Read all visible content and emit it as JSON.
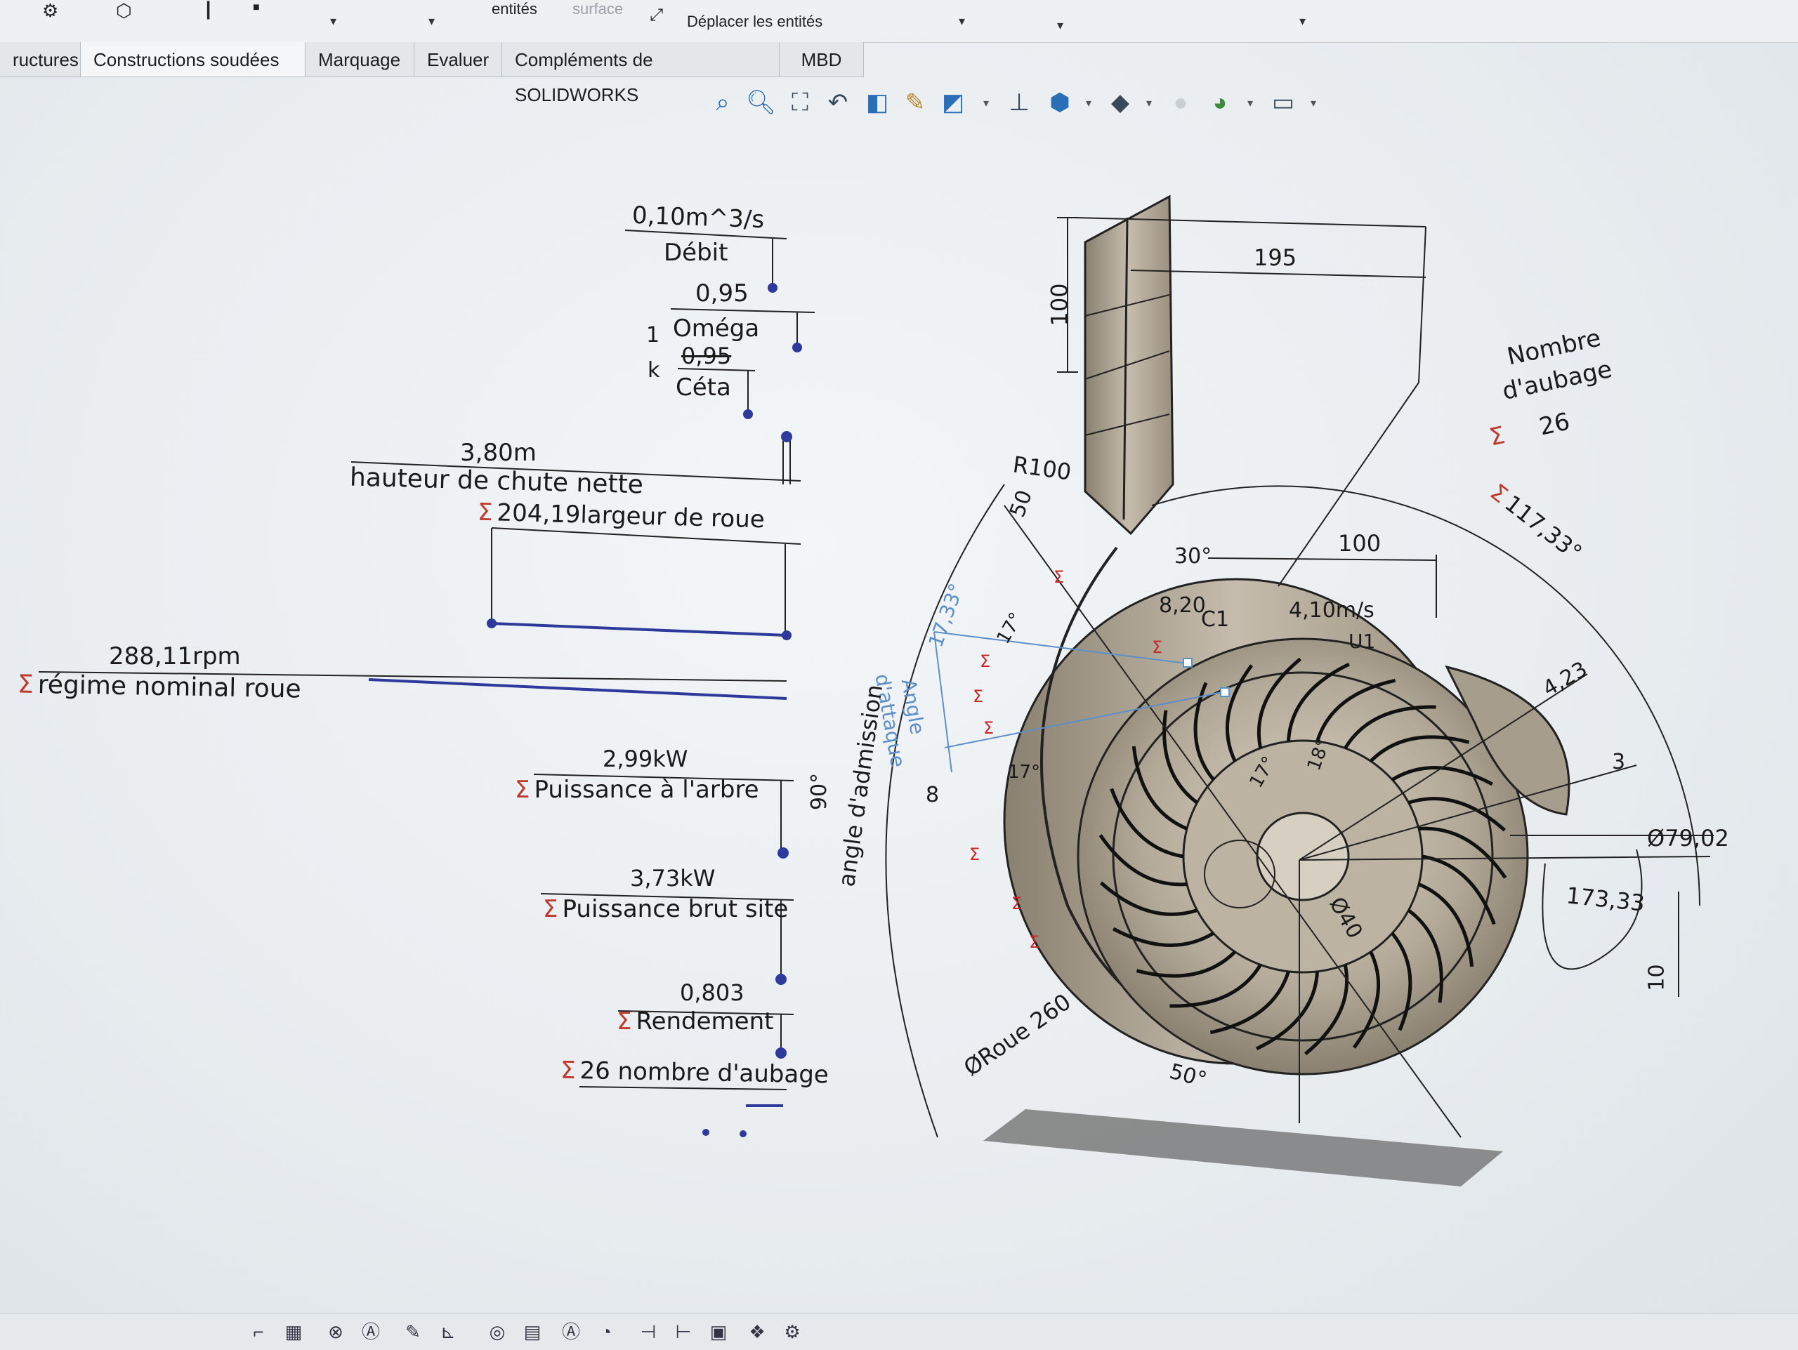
{
  "toolbar": {
    "item_entites": "entités",
    "item_surface": "surface",
    "move_entities": "Déplacer les entités"
  },
  "tabs": [
    {
      "label": "ructures"
    },
    {
      "label": "Constructions soudées"
    },
    {
      "label": "Marquage"
    },
    {
      "label": "Evaluer"
    },
    {
      "label": "Compléments de SOLIDWORKS"
    },
    {
      "label": "MBD"
    }
  ],
  "view_tools": [
    "zoom-to-fit-icon",
    "zoom-area-icon",
    "zoom-selection-icon",
    "previous-view-icon",
    "section-view-icon",
    "dynamic-annotation-icon",
    "view-orientation-icon",
    "triad-icon",
    "display-style-icon",
    "hide-show-icon",
    "edit-appearance-icon",
    "scene-icon",
    "monitor-icon"
  ],
  "equations": {
    "debit_value": "0,10m^3/s",
    "debit_label": "Débit",
    "omega_value": "0,95",
    "omega_label": "Oméga",
    "k_num": "1",
    "k_label": "k",
    "ceta_value": "0,95",
    "ceta_label": "Céta",
    "hauteur_value": "3,80m",
    "hauteur_label": "hauteur de chute nette",
    "largeur": "204,19largeur de roue",
    "regime_value": "288,11rpm",
    "regime_label": "régime nominal roue",
    "puissance_arbre_value": "2,99kW",
    "puissance_arbre_label": "Puissance à l'arbre",
    "puissance_brut_value": "3,73kW",
    "puissance_brut_label": "Puissance brut site",
    "rendement_value": "0,803",
    "rendement_label": "Rendement",
    "nombre_aubage_text": "26 nombre d'aubage",
    "sigma": "Σ"
  },
  "dimensions": {
    "d195": "195",
    "d100_vert": "100",
    "nombre_title1": "Nombre",
    "nombre_title2": "d'aubage",
    "nombre_value": "26",
    "angle_117": "117,33°",
    "r100": "R100",
    "d50": "50",
    "d30": "30°",
    "d100_h": "100",
    "d820": "8,20",
    "c1": "C1",
    "v410": "4,10m/s",
    "u1": "U1",
    "angle_1733": "17,33°",
    "angle_dattaque1": "Angle",
    "angle_dattaque2": "d'attaque",
    "angle_admission": "angle d'admission",
    "deg90": "90°",
    "d8": "8",
    "d423": "4,23",
    "d3": "3",
    "phi7902": "Ø79,02",
    "d17333": "173,33",
    "d10": "10",
    "phi40": "Ø40",
    "phi_roue": "ØRoue 260",
    "deg50": "50°",
    "deg17": "17°",
    "deg18": "18°"
  }
}
